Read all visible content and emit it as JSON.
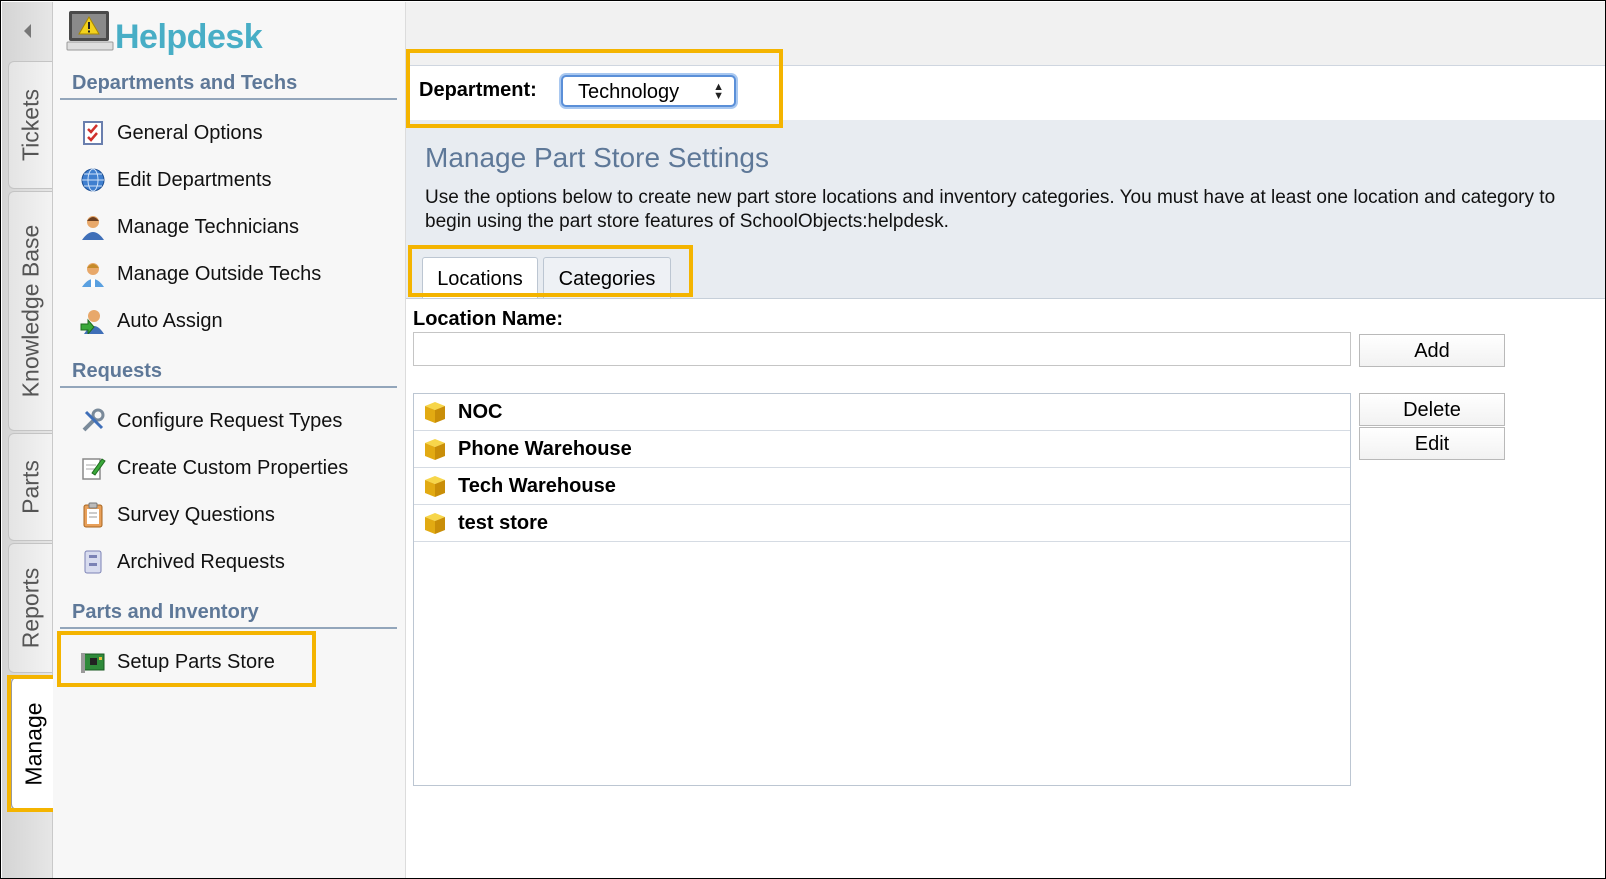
{
  "app": {
    "title": "Helpdesk"
  },
  "vertical_tabs": [
    {
      "label": "Tickets",
      "active": false
    },
    {
      "label": "Knowledge Base",
      "active": false
    },
    {
      "label": "Parts",
      "active": false
    },
    {
      "label": "Reports",
      "active": false
    },
    {
      "label": "Manage",
      "active": true
    }
  ],
  "sidebar": {
    "sections": [
      {
        "title": "Departments and Techs",
        "items": [
          {
            "label": "General Options",
            "icon": "checklist-icon"
          },
          {
            "label": "Edit Departments",
            "icon": "globe-icon"
          },
          {
            "label": "Manage Technicians",
            "icon": "technician-icon"
          },
          {
            "label": "Manage Outside Techs",
            "icon": "outside-tech-icon"
          },
          {
            "label": "Auto Assign",
            "icon": "auto-assign-icon"
          }
        ]
      },
      {
        "title": "Requests",
        "items": [
          {
            "label": "Configure Request Types",
            "icon": "tools-icon"
          },
          {
            "label": "Create Custom Properties",
            "icon": "edit-note-icon"
          },
          {
            "label": "Survey Questions",
            "icon": "clipboard-icon"
          },
          {
            "label": "Archived Requests",
            "icon": "archive-icon"
          }
        ]
      },
      {
        "title": "Parts and Inventory",
        "items": [
          {
            "label": "Setup Parts Store",
            "icon": "circuit-board-icon"
          }
        ]
      }
    ]
  },
  "department": {
    "label": "Department:",
    "selected": "Technology"
  },
  "panel": {
    "title": "Manage Part Store Settings",
    "description": "Use the options below to create new part store locations and inventory categories. You must have at least one location and category to begin using the part store features of SchoolObjects:helpdesk."
  },
  "tabs": [
    {
      "label": "Locations",
      "active": true
    },
    {
      "label": "Categories",
      "active": false
    }
  ],
  "locations": {
    "field_label": "Location Name:",
    "value": "",
    "add_label": "Add",
    "delete_label": "Delete",
    "edit_label": "Edit",
    "items": [
      "NOC",
      "Phone Warehouse",
      "Tech Warehouse",
      "test store"
    ]
  },
  "colors": {
    "highlight": "#f4b400",
    "brand": "#48aec6",
    "section": "#5e7898"
  }
}
